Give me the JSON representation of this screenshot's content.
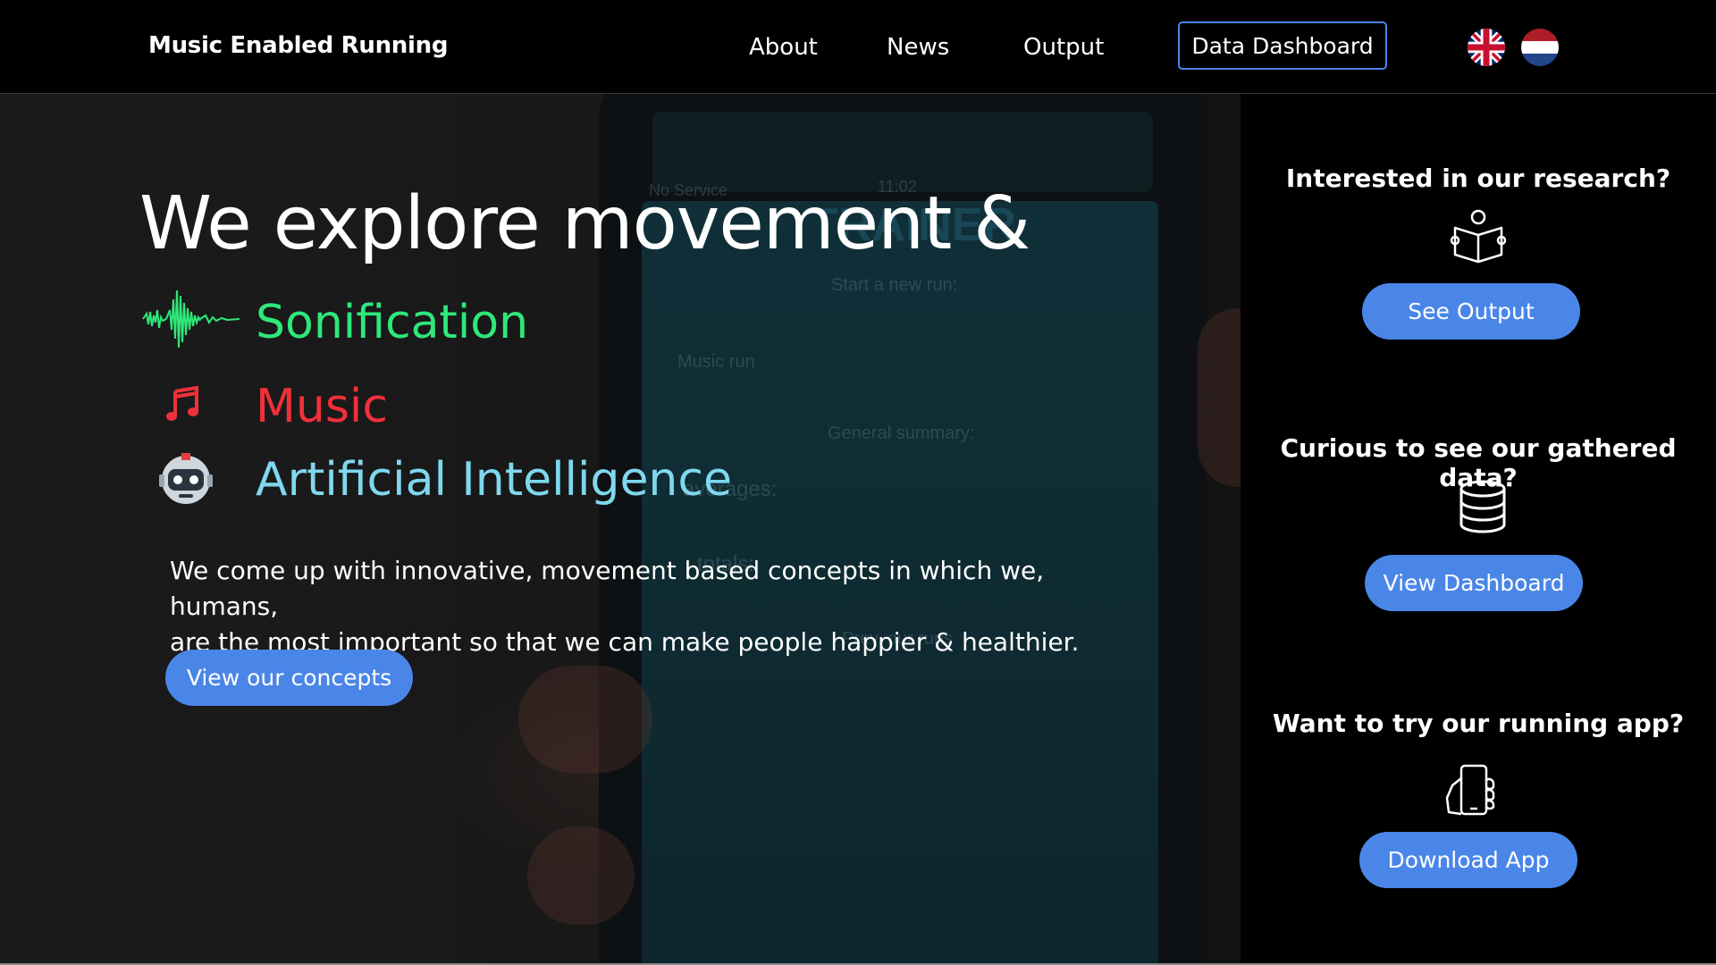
{
  "nav": {
    "brand": "Music Enabled Running",
    "links": [
      "About",
      "News",
      "Output"
    ],
    "dashboard_button": "Data Dashboard",
    "languages": [
      "English",
      "Dutch"
    ]
  },
  "hero": {
    "headline": "We explore movement &",
    "topics": [
      {
        "label": "Sonification",
        "color": "#2ee87a",
        "icon": "waveform-icon"
      },
      {
        "label": "Music",
        "color": "#f0303a",
        "icon": "music-note-icon"
      },
      {
        "label": "Artificial Intelligence",
        "color": "#7fd8ee",
        "icon": "robot-icon"
      }
    ],
    "description_line1": "We come up with innovative, movement based concepts in which we, humans,",
    "description_line2": "are the most important so that we can make people happier & healthier.",
    "cta": "View our concepts",
    "background_screen": {
      "status": "No Service",
      "time": "11:02",
      "app_title": "TRAINER",
      "start": "Start a new run:",
      "tab": "Music run",
      "summary": "General summary:",
      "averages_label": "averages:",
      "totals_label": "totals:",
      "prev_label": "Prev. our runs"
    }
  },
  "side": {
    "items": [
      {
        "question": "Interested in our research?",
        "icon": "book-reader-icon",
        "button": "See Output"
      },
      {
        "question": "Curious to see our gathered data?",
        "icon": "database-icon",
        "button": "View Dashboard"
      },
      {
        "question": "Want to try our running app?",
        "icon": "phone-hand-icon",
        "button": "Download App"
      }
    ]
  },
  "colors": {
    "accent": "#4a86e8",
    "background": "#000000"
  }
}
